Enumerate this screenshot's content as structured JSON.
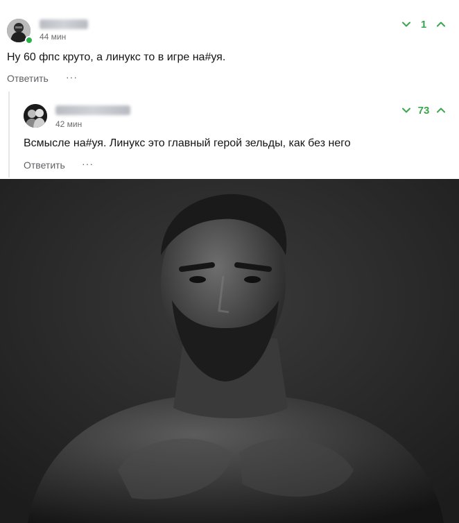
{
  "comments": [
    {
      "time": "44 мин",
      "text": "Ну 60 фпс круто, а линукс то в игре на#уя.",
      "reply_label": "Ответить",
      "more_label": "···",
      "score": "1",
      "online": true
    },
    {
      "time": "42 мин",
      "text": "Всмысле на#уя. Линукс это главный герой зельды, как без него",
      "reply_label": "Ответить",
      "more_label": "···",
      "score": "73"
    }
  ],
  "icons": {
    "downvote": "chevron-down-icon",
    "upvote": "chevron-up-icon"
  },
  "colors": {
    "vote_green": "#3aa64b",
    "online_green": "#2bb24c",
    "photo_background": "#262626"
  }
}
